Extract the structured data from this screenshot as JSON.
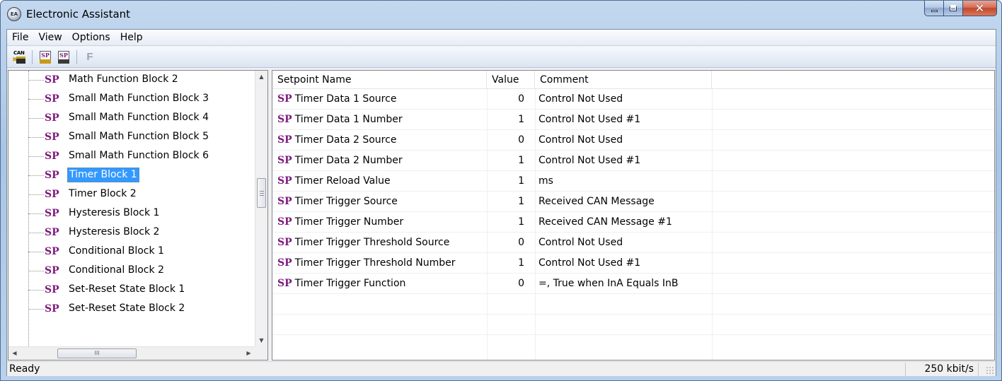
{
  "window": {
    "title": "Electronic Assistant",
    "icon": "app-logo-icon"
  },
  "menu": [
    "File",
    "View",
    "Options",
    "Help"
  ],
  "toolbar": {
    "buttons": [
      {
        "name": "can-connect-icon",
        "label": "CAN"
      },
      {
        "name": "open-setpoint-icon",
        "label": "SP"
      },
      {
        "name": "save-setpoint-icon",
        "label": "SP"
      },
      {
        "name": "flash-icon",
        "label": "F"
      }
    ]
  },
  "tree": {
    "sp_label": "SP",
    "items": [
      "Math Function Block 2",
      "Small Math Function Block 3",
      "Small Math Function Block 4",
      "Small Math Function Block 5",
      "Small Math Function Block 6",
      "Timer Block 1",
      "Timer Block 2",
      "Hysteresis Block 1",
      "Hysteresis Block 2",
      "Conditional Block 1",
      "Conditional Block 2",
      "Set-Reset State Block 1",
      "Set-Reset State Block 2"
    ],
    "selected": "Timer Block 1",
    "hscroll_thumb_text": "III"
  },
  "table": {
    "columns": [
      "Setpoint Name",
      "Value",
      "Comment"
    ],
    "sp_label": "SP",
    "rows": [
      {
        "name": "Timer Data 1 Source",
        "value": "0",
        "comment": "Control Not Used"
      },
      {
        "name": "Timer Data 1 Number",
        "value": "1",
        "comment": "Control Not Used #1"
      },
      {
        "name": "Timer Data 2 Source",
        "value": "0",
        "comment": "Control Not Used"
      },
      {
        "name": "Timer Data 2 Number",
        "value": "1",
        "comment": "Control Not Used #1"
      },
      {
        "name": "Timer Reload Value",
        "value": "1",
        "comment": "ms"
      },
      {
        "name": "Timer Trigger Source",
        "value": "1",
        "comment": "Received CAN Message"
      },
      {
        "name": "Timer Trigger Number",
        "value": "1",
        "comment": "Received CAN Message #1"
      },
      {
        "name": "Timer Trigger Threshold Source",
        "value": "0",
        "comment": "Control Not Used"
      },
      {
        "name": "Timer Trigger Threshold Number",
        "value": "1",
        "comment": "Control Not Used #1"
      },
      {
        "name": "Timer Trigger Function",
        "value": "0",
        "comment": "=,   True when InA Equals InB"
      }
    ]
  },
  "status": {
    "text": "Ready",
    "baud": "250 kbit/s"
  }
}
